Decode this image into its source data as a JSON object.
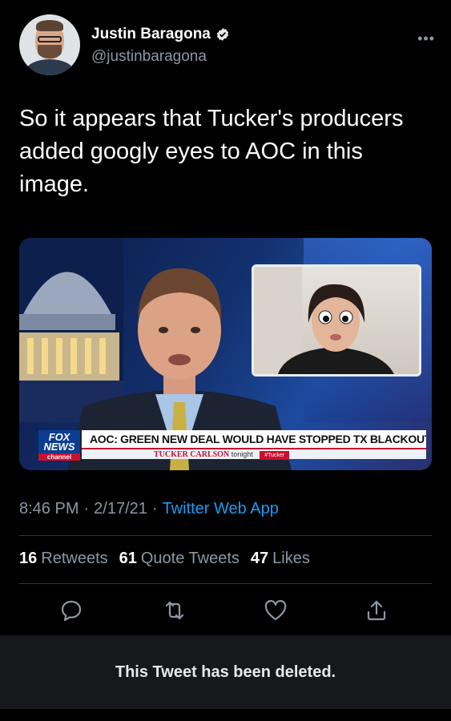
{
  "author": {
    "name": "Justin Baragona",
    "handle": "@justinbaragona",
    "verified": true,
    "more_icon": "more-dots-icon"
  },
  "tweet": {
    "text": "So it appears that Tucker's producers added googly eyes to AOC in this image.",
    "time": "8:46 PM",
    "date": "2/17/21",
    "separator": "·",
    "source": "Twitter Web App"
  },
  "media": {
    "network_logo_top": "FOX",
    "network_logo_mid": "NEWS",
    "network_logo_bottom": "channel",
    "headline": "AOC: GREEN NEW DEAL WOULD HAVE STOPPED TX BLACKOUT",
    "show_name": "TUCKER CARLSON",
    "show_suffix": "tonight",
    "hashtag": "#Tucker"
  },
  "stats": {
    "retweets_count": "16",
    "retweets_label": "Retweets",
    "quotes_count": "61",
    "quotes_label": "Quote Tweets",
    "likes_count": "47",
    "likes_label": "Likes"
  },
  "actions": [
    "reply-icon",
    "retweet-icon",
    "like-icon",
    "share-icon"
  ],
  "notice": "This Tweet has been deleted.",
  "colors": {
    "background": "#000000",
    "accent": "#1d9bf0",
    "secondary_text": "#8b98a5",
    "notice_bg": "#16181c"
  }
}
